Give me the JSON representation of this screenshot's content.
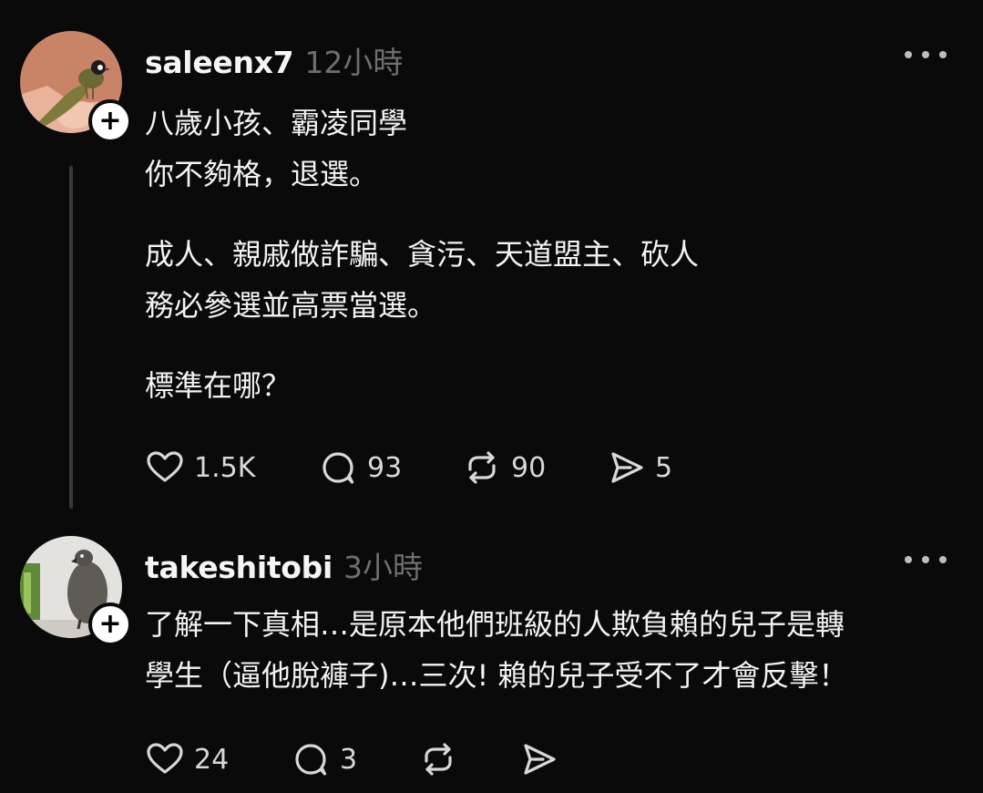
{
  "posts": [
    {
      "username": "saleenx7",
      "time": "12小時",
      "lines": [
        "八歲小孩、霸凌同學",
        "你不夠格，退選。",
        "成人、親戚做詐騙、貪污、天道盟主、砍人",
        "務必參選並高票當選。",
        "標準在哪？"
      ],
      "likes": "1.5K",
      "comments": "93",
      "reposts": "90",
      "shares": "5",
      "avatar_icon": "bird-on-hand-avatar"
    },
    {
      "username": "takeshitobi",
      "time": "3小時",
      "lines": [
        "了解一下真相…是原本他們班級的人欺負賴的兒子是轉",
        "學生（逼他脫褲子)…三次! 賴的兒子受不了才會反擊！"
      ],
      "likes": "24",
      "comments": "3",
      "reposts": "",
      "shares": "",
      "avatar_icon": "grey-parrot-avatar"
    }
  ],
  "icons": {
    "follow": "plus-icon",
    "more": "more-dots-icon",
    "like": "heart-icon",
    "comment": "comment-bubble-icon",
    "repost": "repost-arrows-icon",
    "share": "send-icon"
  },
  "colors": {
    "background": "#0a0a0a",
    "text": "#f3f3f3",
    "muted": "#6e6e6e",
    "thread_line": "#3a3a3a"
  }
}
